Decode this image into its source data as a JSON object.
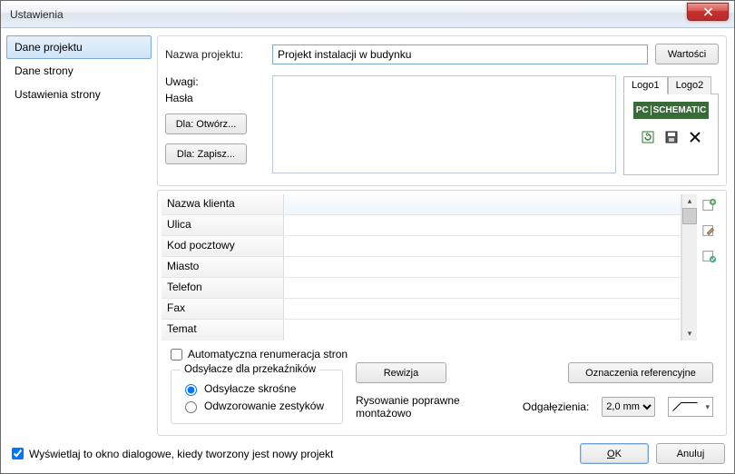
{
  "window": {
    "title": "Ustawienia"
  },
  "sidebar": {
    "items": [
      {
        "label": "Dane projektu",
        "selected": true
      },
      {
        "label": "Dane strony"
      },
      {
        "label": "Ustawienia strony"
      }
    ]
  },
  "project": {
    "name_label": "Nazwa projektu:",
    "name_value": "Projekt instalacji w budynku",
    "values_button": "Wartości"
  },
  "notes": {
    "label1": "Uwagi:",
    "label2": "Hasła",
    "open_for": "Dla: Otwórz...",
    "save_for": "Dla: Zapisz...",
    "text": ""
  },
  "logo": {
    "tab1": "Logo1",
    "tab2": "Logo2",
    "brand_left": "PC",
    "brand_right": "SCHEMATIC"
  },
  "grid": {
    "rows": [
      {
        "label": "Nazwa klienta",
        "value": ""
      },
      {
        "label": "Ulica",
        "value": ""
      },
      {
        "label": "Kod pocztowy",
        "value": ""
      },
      {
        "label": "Miasto",
        "value": ""
      },
      {
        "label": "Telefon",
        "value": ""
      },
      {
        "label": "Fax",
        "value": ""
      },
      {
        "label": "Temat",
        "value": ""
      }
    ]
  },
  "options": {
    "auto_renum": "Automatyczna renumeracja stron",
    "relay_legend": "Odsyłacze dla przekaźników",
    "cross_ref": "Odsyłacze skrośne",
    "contact_map": "Odwzorowanie zestyków",
    "revision": "Rewizja",
    "ref_desig": "Oznaczenia referencyjne",
    "mount_correct": "Rysowanie poprawne montażowo",
    "branches_label": "Odgałęzienia:",
    "branches_value": "2,0 mm"
  },
  "footer": {
    "show_on_new": "Wyświetlaj to okno dialogowe, kiedy tworzony jest nowy projekt",
    "ok": "OK",
    "cancel": "Anuluj"
  }
}
